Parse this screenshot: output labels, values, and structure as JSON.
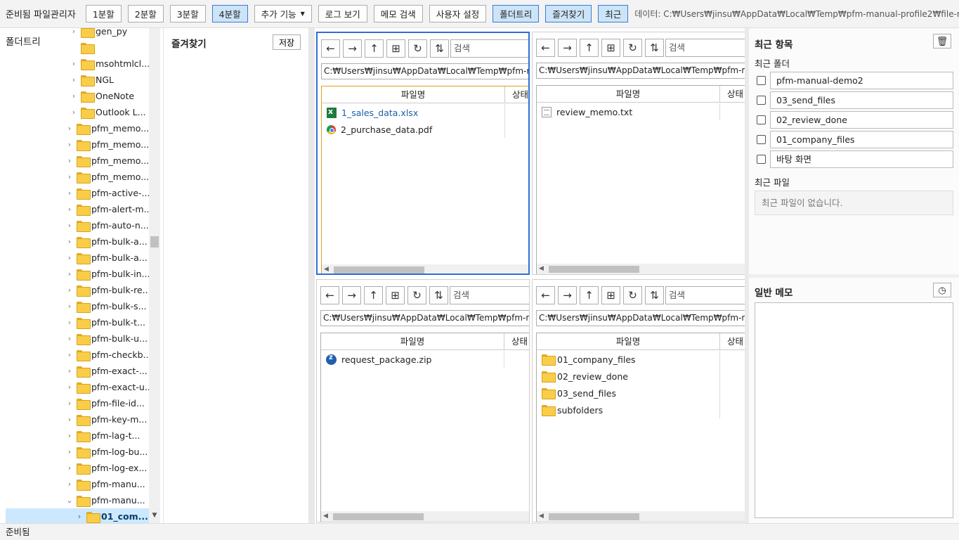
{
  "app": {
    "title": "준비됨 파일관리자",
    "data_path": "데이터: C:₩Users₩jinsu₩AppData₩Local₩Temp₩pfm-manual-profile2₩file-m..."
  },
  "toolbar": {
    "split1": "1분할",
    "split2": "2분할",
    "split3": "3분할",
    "split4": "4분할",
    "more": "추가 기능",
    "log": "로그 보기",
    "memo_search": "메모 검색",
    "user_settings": "사용자 설정",
    "folder_tree": "폴더트리",
    "favorites": "즐겨찾기",
    "recent": "최근"
  },
  "tree": {
    "title": "폴더트리",
    "items": [
      {
        "label": "gen_py",
        "indent": 2,
        "expander": "›"
      },
      {
        "label": "",
        "indent": 2,
        "expander": ""
      },
      {
        "label": "msohtmlcl...",
        "indent": 2,
        "expander": "›"
      },
      {
        "label": "NGL",
        "indent": 2,
        "expander": "›"
      },
      {
        "label": "OneNote",
        "indent": 2,
        "expander": "›"
      },
      {
        "label": "Outlook L...",
        "indent": 2,
        "expander": "›"
      },
      {
        "label": "pfm_memo...",
        "indent": 1,
        "expander": "›"
      },
      {
        "label": "pfm_memo...",
        "indent": 1,
        "expander": "›"
      },
      {
        "label": "pfm_memo...",
        "indent": 1,
        "expander": "›"
      },
      {
        "label": "pfm_memo...",
        "indent": 1,
        "expander": "›"
      },
      {
        "label": "pfm-active-...",
        "indent": 1,
        "expander": "›"
      },
      {
        "label": "pfm-alert-m...",
        "indent": 1,
        "expander": "›"
      },
      {
        "label": "pfm-auto-n...",
        "indent": 1,
        "expander": "›"
      },
      {
        "label": "pfm-bulk-a...",
        "indent": 1,
        "expander": "›"
      },
      {
        "label": "pfm-bulk-a...",
        "indent": 1,
        "expander": "›"
      },
      {
        "label": "pfm-bulk-in...",
        "indent": 1,
        "expander": "›"
      },
      {
        "label": "pfm-bulk-re...",
        "indent": 1,
        "expander": "›"
      },
      {
        "label": "pfm-bulk-s...",
        "indent": 1,
        "expander": "›"
      },
      {
        "label": "pfm-bulk-t...",
        "indent": 1,
        "expander": "›"
      },
      {
        "label": "pfm-bulk-u...",
        "indent": 1,
        "expander": "›"
      },
      {
        "label": "pfm-checkb...",
        "indent": 1,
        "expander": "›"
      },
      {
        "label": "pfm-exact-...",
        "indent": 1,
        "expander": "›"
      },
      {
        "label": "pfm-exact-u...",
        "indent": 1,
        "expander": "›"
      },
      {
        "label": "pfm-file-id...",
        "indent": 1,
        "expander": "›"
      },
      {
        "label": "pfm-key-m...",
        "indent": 1,
        "expander": "›"
      },
      {
        "label": "pfm-lag-t...",
        "indent": 1,
        "expander": "›"
      },
      {
        "label": "pfm-log-bu...",
        "indent": 1,
        "expander": "›"
      },
      {
        "label": "pfm-log-ex...",
        "indent": 1,
        "expander": "›"
      },
      {
        "label": "pfm-manu...",
        "indent": 1,
        "expander": "›"
      },
      {
        "label": "pfm-manu...",
        "indent": 1,
        "expander": "⌄"
      },
      {
        "label": "01_com...",
        "indent": 2,
        "expander": "›",
        "selected": true
      }
    ]
  },
  "favorites": {
    "title": "즐겨찾기",
    "save": "저장"
  },
  "pane_common": {
    "search_placeholder": "검색",
    "col_name": "파일명",
    "col_status": "상태"
  },
  "panes": [
    {
      "id": "top-left",
      "focused": true,
      "path": "C:₩Users₩jinsu₩AppData₩Local₩Temp₩pfm-manual",
      "files": [
        {
          "name": "1_sales_data.xlsx",
          "type": "xlsx",
          "highlight": true
        },
        {
          "name": "2_purchase_data.pdf",
          "type": "pdf"
        }
      ]
    },
    {
      "id": "top-right",
      "path": "C:₩Users₩jinsu₩AppData₩Local₩Temp₩pfm-manual",
      "files": [
        {
          "name": "review_memo.txt",
          "type": "txt"
        }
      ]
    },
    {
      "id": "bottom-left",
      "path": "C:₩Users₩jinsu₩AppData₩Local₩Temp₩pfm-manual",
      "files": [
        {
          "name": "request_package.zip",
          "type": "zip"
        }
      ]
    },
    {
      "id": "bottom-right",
      "path": "C:₩Users₩jinsu₩AppData₩Local₩Temp₩pfm-manual",
      "files": [
        {
          "name": "01_company_files",
          "type": "folder"
        },
        {
          "name": "02_review_done",
          "type": "folder"
        },
        {
          "name": "03_send_files",
          "type": "folder"
        },
        {
          "name": "subfolders",
          "type": "folder"
        }
      ]
    }
  ],
  "recent": {
    "title": "최근 항목",
    "folders_title": "최근 폴더",
    "folders": [
      "pfm-manual-demo2",
      "03_send_files",
      "02_review_done",
      "01_company_files",
      "바탕 화면"
    ],
    "files_title": "최근 파일",
    "files_empty": "최근 파일이 없습니다."
  },
  "memo": {
    "title": "일반 메모"
  },
  "status": {
    "text": "준비됨"
  },
  "icons": {
    "back": "arrow-left-icon",
    "forward": "arrow-right-icon",
    "up": "arrow-up-icon",
    "new": "new-folder-icon",
    "refresh": "refresh-icon",
    "sort": "sort-icon",
    "trash": "trash-icon",
    "clock": "clock-icon"
  },
  "colors": {
    "accent": "#2f6ed8",
    "active_button": "#cce4f7",
    "selection": "#cce8ff",
    "folder": "#f9cd48"
  }
}
